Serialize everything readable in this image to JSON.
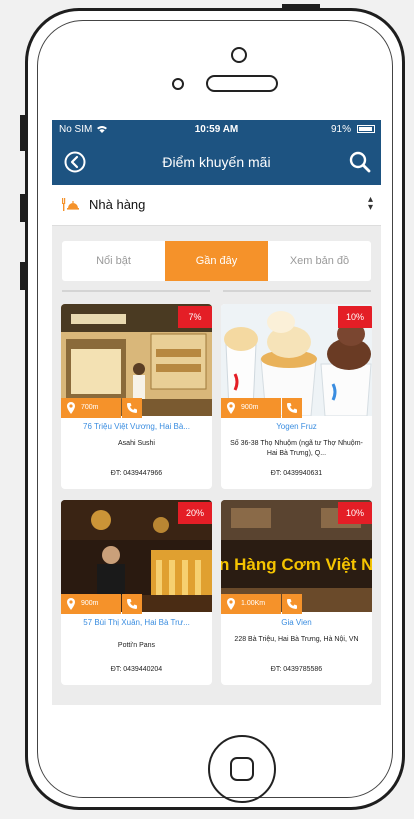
{
  "status_bar": {
    "carrier": "No SIM",
    "time": "10:59 AM",
    "battery": "91%",
    "battery_level": 0.91
  },
  "header": {
    "title": "Điểm khuyến mãi",
    "back_icon": "back-circle-icon",
    "search_icon": "search-icon"
  },
  "category": {
    "label": "Nhà hàng",
    "icon": "restaurant-icon",
    "arrow_icon": "up-down-arrow-icon"
  },
  "tabs": [
    {
      "label": "Nổi bật",
      "active": false
    },
    {
      "label": "Gần đây",
      "active": true
    },
    {
      "label": "Xem bản đồ",
      "active": false
    }
  ],
  "colors": {
    "primary": "#1d5381",
    "accent": "#f5922a",
    "badge": "#e41e26",
    "link": "#3a8de0"
  },
  "cards": [
    {
      "discount": "7%",
      "distance": "700m",
      "name": "76 Triệu Việt Vương, Hai Bà...",
      "address": "Asahi Sushi",
      "phone": "ĐT: 0439447966"
    },
    {
      "discount": "10%",
      "distance": "900m",
      "name": "Yogen Fruz",
      "address": "Số 36-38 Thọ Nhuộm (ngã tư Thợ Nhuộm- Hai Bà Trưng), Q...",
      "phone": "ĐT: 0439940631"
    },
    {
      "discount": "20%",
      "distance": "900m",
      "name": "57 Bùi Thị Xuân, Hai Bà Trư...",
      "address": "Potti'n Pans",
      "phone": "ĐT: 0439440204"
    },
    {
      "discount": "10%",
      "distance": "1.00Km",
      "name": "Gia Vien",
      "address": "228 Bà Triệu, Hai Bà Trưng, Hà Nội, VN",
      "phone": "ĐT: 0439785586",
      "photo_text": "n Hàng Cơm Việt N"
    }
  ]
}
